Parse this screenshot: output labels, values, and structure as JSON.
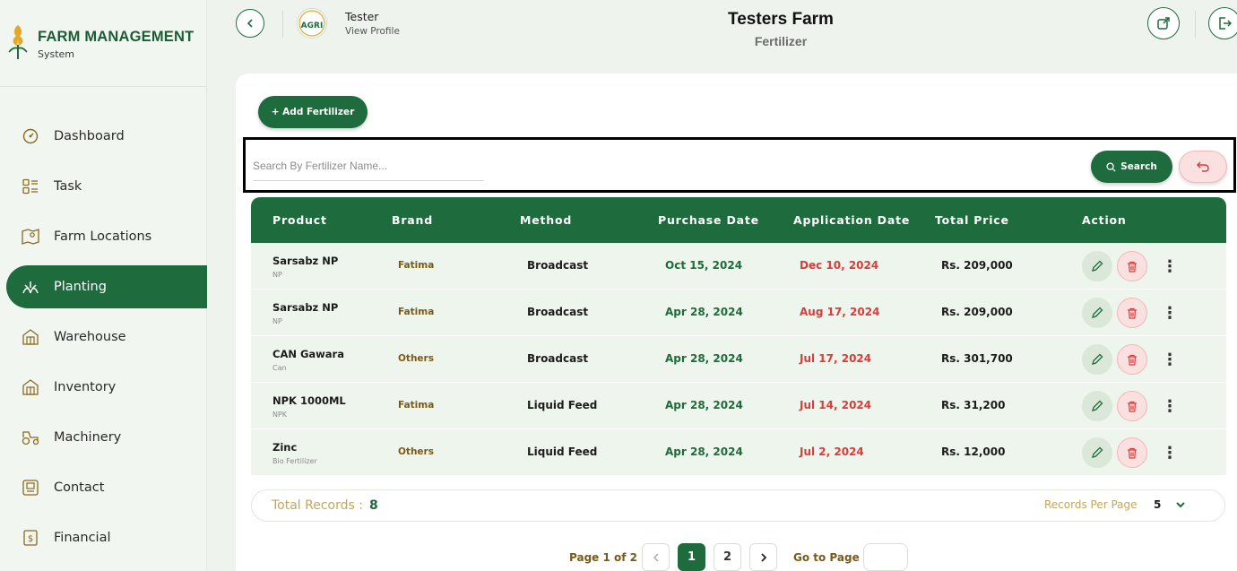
{
  "brand": {
    "title": "FARM MANAGEMENT",
    "subtitle": "System"
  },
  "sidebar": {
    "items": [
      {
        "label": "Dashboard",
        "icon": "dashboard-icon"
      },
      {
        "label": "Task",
        "icon": "task-icon"
      },
      {
        "label": "Farm Locations",
        "icon": "map-icon"
      },
      {
        "label": "Planting",
        "icon": "planting-icon",
        "active": true
      },
      {
        "label": "Warehouse",
        "icon": "warehouse-icon"
      },
      {
        "label": "Inventory",
        "icon": "inventory-icon"
      },
      {
        "label": "Machinery",
        "icon": "tractor-icon"
      },
      {
        "label": "Contact",
        "icon": "contact-icon"
      },
      {
        "label": "Financial",
        "icon": "financial-icon"
      }
    ]
  },
  "header": {
    "user_name": "Tester",
    "user_link": "View Profile",
    "avatar_text": "AGRI",
    "farm_title": "Testers Farm",
    "farm_subtitle": "Fertilizer"
  },
  "toolbar": {
    "add_label": "+ Add Fertilizer",
    "search_placeholder": "Search By Fertilizer Name...",
    "search_label": "Search"
  },
  "table": {
    "columns": [
      "Product",
      "Brand",
      "Method",
      "Purchase Date",
      "Application Date",
      "Total Price",
      "Action"
    ],
    "rows": [
      {
        "product": "Sarsabz NP",
        "type": "NP",
        "brand": "Fatima",
        "method": "Broadcast",
        "purchase": "Oct 15, 2024",
        "application": "Dec 10, 2024",
        "price": "Rs. 209,000"
      },
      {
        "product": "Sarsabz NP",
        "type": "NP",
        "brand": "Fatima",
        "method": "Broadcast",
        "purchase": "Apr 28, 2024",
        "application": "Aug 17, 2024",
        "price": "Rs. 209,000"
      },
      {
        "product": "CAN Gawara",
        "type": "Can",
        "brand": "Others",
        "method": "Broadcast",
        "purchase": "Apr 28, 2024",
        "application": "Jul 17, 2024",
        "price": "Rs. 301,700"
      },
      {
        "product": "NPK 1000ML",
        "type": "NPK",
        "brand": "Fatima",
        "method": "Liquid Feed",
        "purchase": "Apr 28, 2024",
        "application": "Jul 14, 2024",
        "price": "Rs. 31,200"
      },
      {
        "product": "Zinc",
        "type": "Bio Fertilizer",
        "brand": "Others",
        "method": "Liquid Feed",
        "purchase": "Apr 28, 2024",
        "application": "Jul 2, 2024",
        "price": "Rs. 12,000"
      }
    ]
  },
  "footer": {
    "total_label": "Total Records :",
    "total_value": "8",
    "rpp_label": "Records Per Page",
    "rpp_value": "5"
  },
  "pagination": {
    "info": "Page 1 of 2",
    "pages": [
      "1",
      "2"
    ],
    "goto_label": "Go to Page"
  },
  "colors": {
    "primary": "#1e6b3d",
    "danger": "#d93c3c",
    "accent_gold": "#c5a65b"
  }
}
